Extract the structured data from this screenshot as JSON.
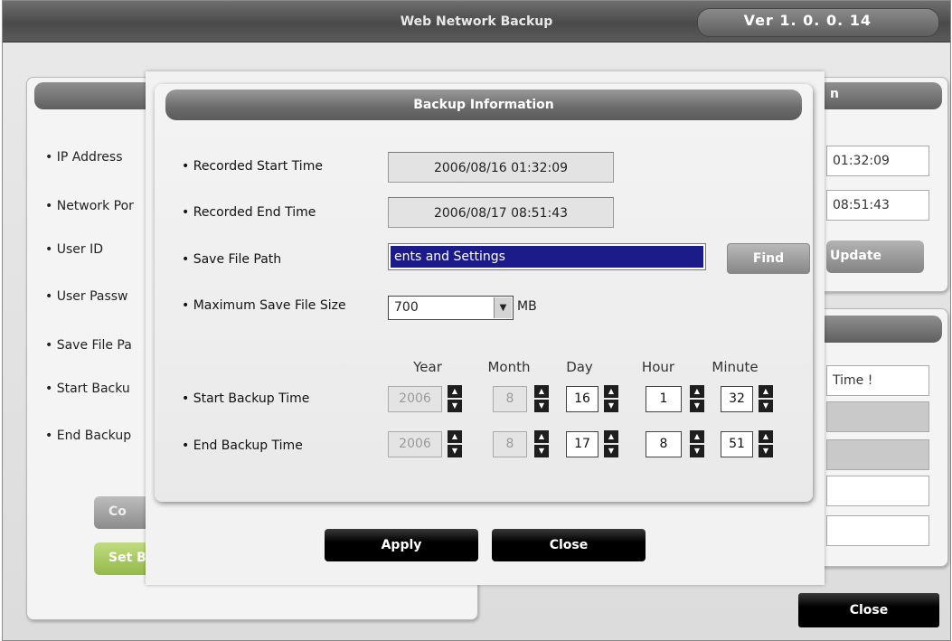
{
  "app": {
    "title": "Web Network Backup",
    "version": "Ver 1. 0. 0. 14"
  },
  "left_panel": {
    "labels": [
      "IP Address",
      "Network Por",
      "User ID",
      "User Passw",
      "Save File Pa",
      "Start Backu",
      "End Backup"
    ],
    "buttons": {
      "connect": "Co",
      "set_backup": "Set B"
    }
  },
  "right_panel": {
    "header_fragment": "n",
    "start_time_fragment": "01:32:09",
    "end_time_fragment": "08:51:43",
    "update_button": "Update",
    "status_fragment": "Time !"
  },
  "dialog": {
    "title": "Backup Information",
    "recorded_start_label": "Recorded Start Time",
    "recorded_start_value": "2006/08/16 01:32:09",
    "recorded_end_label": "Recorded End Time",
    "recorded_end_value": "2006/08/17 08:51:43",
    "save_path_label": "Save File Path",
    "save_path_value": "ents and Settings",
    "find_button": "Find",
    "max_size_label": "Maximum Save File Size",
    "max_size_value": "700",
    "max_size_unit": "MB",
    "columns": [
      "Year",
      "Month",
      "Day",
      "Hour",
      "Minute"
    ],
    "start_backup_label": "Start Backup Time",
    "start_backup": {
      "year": "2006",
      "month": "8",
      "day": "16",
      "hour": "1",
      "minute": "32"
    },
    "end_backup_label": "End Backup Time",
    "end_backup": {
      "year": "2006",
      "month": "8",
      "day": "17",
      "hour": "8",
      "minute": "51"
    },
    "apply_button": "Apply",
    "close_button": "Close"
  },
  "main_close_button": "Close",
  "colors": {
    "selection": "#1b1b8a",
    "title_bar": "#4a4a4a",
    "set_button": "#a6c85a"
  }
}
